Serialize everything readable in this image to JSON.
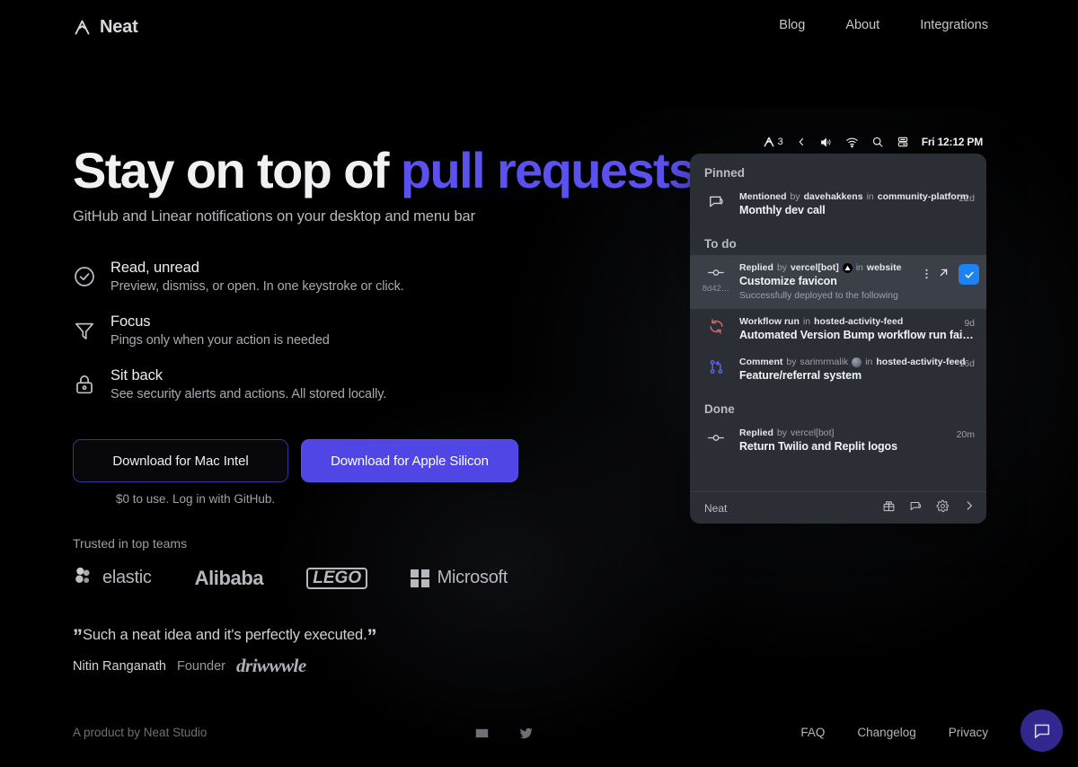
{
  "header": {
    "brand": "Neat",
    "brand_icon": "neat-logo-icon",
    "nav": [
      {
        "label": "Blog"
      },
      {
        "label": "About"
      },
      {
        "label": "Integrations"
      }
    ]
  },
  "hero": {
    "headline_plain": "Stay on top of ",
    "headline_accent": "pull requests",
    "accent_color": "#5b51ef",
    "subhead": "GitHub and Linear notifications on your desktop and menu bar",
    "features": [
      {
        "icon": "check-circle-icon",
        "title": "Read, unread",
        "desc": "Preview, dismiss, or open. In one keystroke or click."
      },
      {
        "icon": "filter-funnel-icon",
        "title": "Focus",
        "desc": "Pings only when your action is needed"
      },
      {
        "icon": "lock-icon",
        "title": "Sit back",
        "desc": "See security alerts and actions. All stored locally."
      }
    ],
    "cta": {
      "secondary_label": "Download for Mac Intel",
      "primary_label": "Download for Apple Silicon",
      "note": "$0 to use. Log in with GitHub."
    },
    "trusted": {
      "label": "Trusted in top teams",
      "logos": [
        {
          "name": "elastic",
          "icon": "elastic-logo-icon"
        },
        {
          "name": "Alibaba",
          "icon": "alibaba-logo-icon"
        },
        {
          "name": "LEGO",
          "icon": "lego-logo-icon"
        },
        {
          "name": "Microsoft",
          "icon": "microsoft-logo-icon"
        }
      ]
    },
    "quote": {
      "open_mark": "”",
      "close_mark": "”",
      "text": "Such a neat idea and it's perfectly executed.",
      "author": "Nitin Ranganath",
      "role": "Founder",
      "company": "driwwwle"
    }
  },
  "app": {
    "menubar": {
      "app_badge_count": "3",
      "app_icon": "neat-logo-icon",
      "icons": [
        "chevron-left-icon",
        "volume-icon",
        "wifi-icon",
        "search-icon",
        "control-center-icon"
      ],
      "clock": "Fri 12:12 PM"
    },
    "sections": [
      {
        "title": "Pinned",
        "items": [
          {
            "icon": "comment-icon",
            "icon_color": "#cfd2d8",
            "kind": "Mentioned",
            "by_label": "by",
            "actor": "davehakkens",
            "in_label": "in",
            "repo": "community-platform",
            "title": "Monthly dev call",
            "time": "22d",
            "selected": false,
            "sub": "",
            "hash": "",
            "actor_badge": "",
            "actions": []
          }
        ]
      },
      {
        "title": "To do",
        "items": [
          {
            "icon": "commit-icon",
            "icon_color": "#cfd2d8",
            "kind": "Replied",
            "by_label": "by",
            "actor": "vercel[bot]",
            "actor_badge": "vercel-triangle-icon",
            "in_label": "in",
            "repo": "website",
            "title": "Customize favicon",
            "sub": "Successfully deployed to the following",
            "hash": "8d42…",
            "time": "",
            "selected": true,
            "actions": [
              "kebab-menu-icon",
              "open-external-icon",
              "mark-done-check-icon"
            ]
          },
          {
            "icon": "workflow-rerun-icon",
            "icon_color": "#d4636a",
            "kind": "Workflow run",
            "by_label": "",
            "actor": "",
            "actor_badge": "",
            "in_label": "in",
            "repo": "hosted-activity-feed",
            "title": "Automated Version Bump workflow run failed…",
            "sub": "",
            "hash": "",
            "time": "9d",
            "selected": false,
            "actions": []
          },
          {
            "icon": "pull-request-icon",
            "icon_color": "#5b61e8",
            "kind": "Comment",
            "by_label": "by",
            "actor": "sarimrmalik",
            "actor_badge": "avatar",
            "in_label": "in",
            "repo": "hosted-activity-feed",
            "title": "Feature/referral system",
            "sub": "",
            "hash": "",
            "time": "16d",
            "selected": false,
            "actions": []
          }
        ]
      },
      {
        "title": "Done",
        "items": [
          {
            "icon": "commit-icon",
            "icon_color": "#cfd2d8",
            "kind": "Replied",
            "by_label": "by",
            "actor": "vercel[bot]",
            "actor_badge": "",
            "in_label": "",
            "repo": "",
            "title": "Return Twilio and Replit logos",
            "sub": "",
            "hash": "",
            "time": "20m",
            "selected": false,
            "actions": []
          }
        ]
      }
    ],
    "footer": {
      "name": "Neat",
      "icons": [
        "gift-icon",
        "feedback-chat-icon",
        "gear-icon",
        "chevron-right-icon"
      ]
    }
  },
  "footer": {
    "credit": "A product by Neat Studio",
    "social": [
      "email-icon",
      "twitter-icon"
    ],
    "links": [
      {
        "label": "FAQ"
      },
      {
        "label": "Changelog"
      },
      {
        "label": "Privacy"
      }
    ],
    "chat_fab_icon": "chat-bubble-icon"
  }
}
